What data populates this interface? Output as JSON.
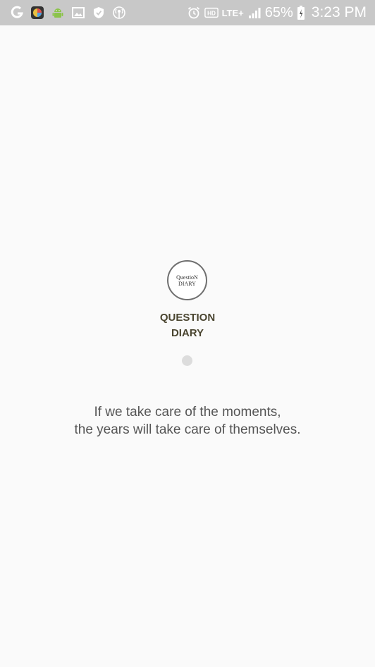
{
  "status_bar": {
    "left_icons": [
      "g-icon",
      "app-color-icon",
      "android-icon",
      "image-icon",
      "shield-icon",
      "broadcast-icon"
    ],
    "right_icons": [
      "alarm-icon",
      "hd-icon",
      "lte-icon",
      "signal-icon",
      "battery-icon"
    ],
    "hd_label": "HD",
    "lte_label": "LTE+",
    "battery_percent": "65%",
    "time": "3:23 PM"
  },
  "splash": {
    "logo_line1": "QuestioN",
    "logo_line2": "DIARY",
    "app_name_line1": "QUESTION",
    "app_name_line2": "DIARY",
    "quote_line1": "If we take care of the moments,",
    "quote_line2": "the years will take care of themselves."
  },
  "colors": {
    "status_bar_bg": "#c8c8c8",
    "background": "#fafafa",
    "app_name": "#4a4530",
    "quote_text": "#555555",
    "loading_dot": "#dcdcdc"
  }
}
